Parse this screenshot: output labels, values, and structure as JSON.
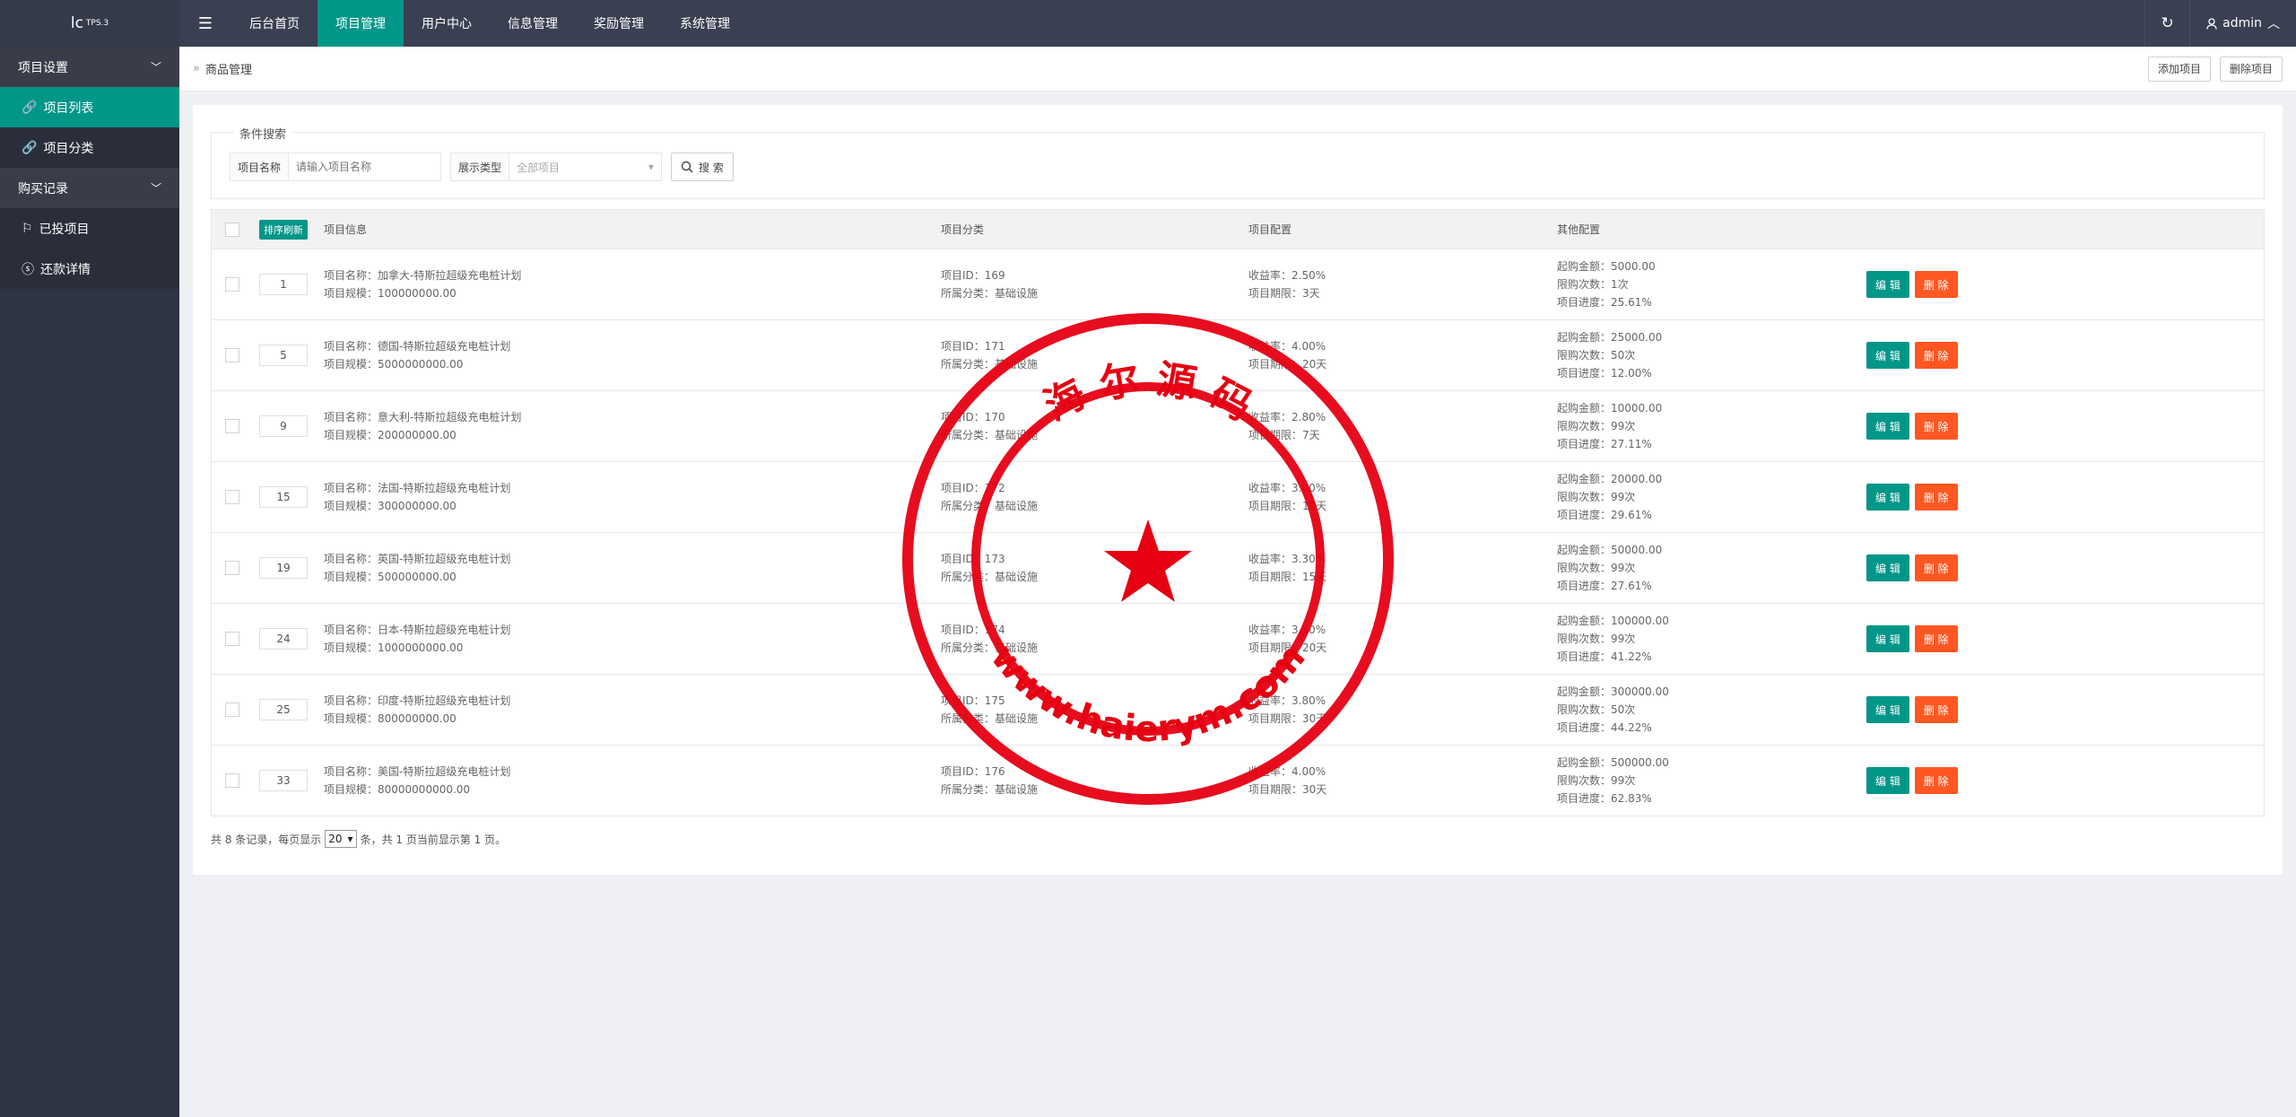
{
  "logo": {
    "text": "lc",
    "version": "TPS.3"
  },
  "topnav": {
    "items": [
      {
        "label": "后台首页",
        "active": false
      },
      {
        "label": "项目管理",
        "active": true
      },
      {
        "label": "用户中心",
        "active": false
      },
      {
        "label": "信息管理",
        "active": false
      },
      {
        "label": "奖励管理",
        "active": false
      },
      {
        "label": "系统管理",
        "active": false
      }
    ],
    "user": "admin"
  },
  "sidebar": {
    "groups": [
      {
        "label": "项目设置",
        "items": [
          {
            "label": "项目列表",
            "active": true
          },
          {
            "label": "项目分类",
            "active": false
          }
        ]
      },
      {
        "label": "购买记录",
        "items": [
          {
            "label": "已投项目",
            "active": false
          },
          {
            "label": "还款详情",
            "active": false
          }
        ]
      }
    ]
  },
  "breadcrumb": {
    "label": "商品管理"
  },
  "actions": {
    "add": "添加项目",
    "delete": "删除项目"
  },
  "search": {
    "legend": "条件搜索",
    "name_label": "项目名称",
    "name_placeholder": "请输入项目名称",
    "type_label": "展示类型",
    "type_value": "全部项目",
    "button": "搜 索"
  },
  "table": {
    "sort_button": "排序刷新",
    "headers": {
      "info": "项目信息",
      "category": "项目分类",
      "config": "项目配置",
      "other": "其他配置"
    },
    "edit_label": "编 辑",
    "delete_label": "删 除",
    "rows": [
      {
        "sort": "1",
        "name": "项目名称：加拿大-特斯拉超级充电桩计划",
        "scale": "项目规模：100000000.00",
        "pid": "项目ID：169",
        "cat": "所属分类：基础设施",
        "rate": "收益率：2.50%",
        "term": "项目期限：3天",
        "min": "起购金额：5000.00",
        "limit": "限购次数：1次",
        "progress": "项目进度：25.61%"
      },
      {
        "sort": "5",
        "name": "项目名称：德国-特斯拉超级充电桩计划",
        "scale": "项目规模：5000000000.00",
        "pid": "项目ID：171",
        "cat": "所属分类：基础设施",
        "rate": "收益率：4.00%",
        "term": "项目期限：20天",
        "min": "起购金额：25000.00",
        "limit": "限购次数：50次",
        "progress": "项目进度：12.00%"
      },
      {
        "sort": "9",
        "name": "项目名称：意大利-特斯拉超级充电桩计划",
        "scale": "项目规模：200000000.00",
        "pid": "项目ID：170",
        "cat": "所属分类：基础设施",
        "rate": "收益率：2.80%",
        "term": "项目期限：7天",
        "min": "起购金额：10000.00",
        "limit": "限购次数：99次",
        "progress": "项目进度：27.11%"
      },
      {
        "sort": "15",
        "name": "项目名称：法国-特斯拉超级充电桩计划",
        "scale": "项目规模：300000000.00",
        "pid": "项目ID：172",
        "cat": "所属分类：基础设施",
        "rate": "收益率：3.00%",
        "term": "项目期限：10天",
        "min": "起购金额：20000.00",
        "limit": "限购次数：99次",
        "progress": "项目进度：29.61%"
      },
      {
        "sort": "19",
        "name": "项目名称：英国-特斯拉超级充电桩计划",
        "scale": "项目规模：500000000.00",
        "pid": "项目ID：173",
        "cat": "所属分类：基础设施",
        "rate": "收益率：3.30%",
        "term": "项目期限：15天",
        "min": "起购金额：50000.00",
        "limit": "限购次数：99次",
        "progress": "项目进度：27.61%"
      },
      {
        "sort": "24",
        "name": "项目名称：日本-特斯拉超级充电桩计划",
        "scale": "项目规模：1000000000.00",
        "pid": "项目ID：174",
        "cat": "所属分类：基础设施",
        "rate": "收益率：3.50%",
        "term": "项目期限：20天",
        "min": "起购金额：100000.00",
        "limit": "限购次数：99次",
        "progress": "项目进度：41.22%"
      },
      {
        "sort": "25",
        "name": "项目名称：印度-特斯拉超级充电桩计划",
        "scale": "项目规模：800000000.00",
        "pid": "项目ID：175",
        "cat": "所属分类：基础设施",
        "rate": "收益率：3.80%",
        "term": "项目期限：30天",
        "min": "起购金额：300000.00",
        "limit": "限购次数：50次",
        "progress": "项目进度：44.22%"
      },
      {
        "sort": "33",
        "name": "项目名称：美国-特斯拉超级充电桩计划",
        "scale": "项目规模：80000000000.00",
        "pid": "项目ID：176",
        "cat": "所属分类：基础设施",
        "rate": "收益率：4.00%",
        "term": "项目期限：30天",
        "min": "起购金额：500000.00",
        "limit": "限购次数：99次",
        "progress": "项目进度：62.83%"
      }
    ]
  },
  "pager": {
    "prefix": "共 8 条记录，每页显示",
    "page_size": "20",
    "suffix": "条，共 1 页当前显示第 1 页。"
  },
  "stamp": {
    "top_text": "海 尔 源 码",
    "bottom_text": "www.haierym.com",
    "color": "#e60012"
  }
}
